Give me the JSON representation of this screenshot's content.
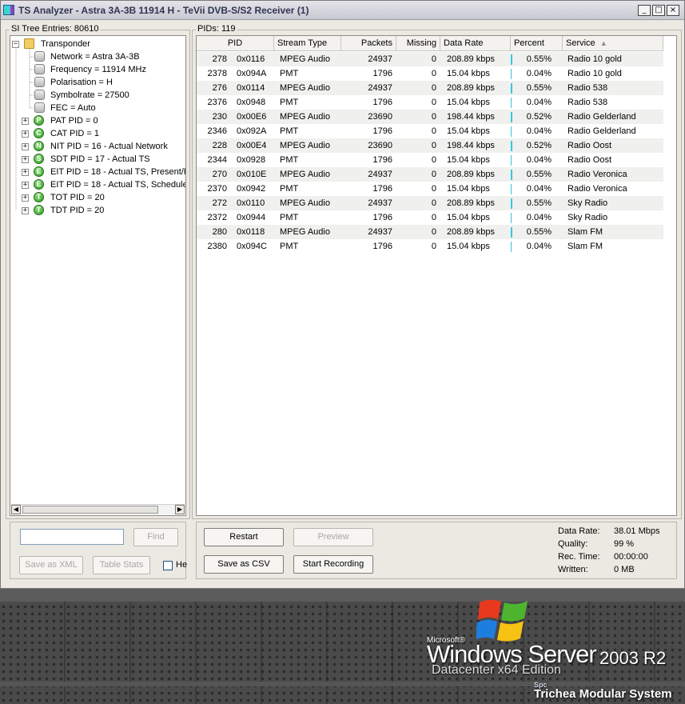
{
  "window": {
    "title": "TS Analyzer - Astra 3A-3B 11914 H - TeVii DVB-S/S2 Receiver (1)",
    "minimize_glyph": "_",
    "maximize_glyph": "□",
    "close_glyph": "×"
  },
  "si_tree": {
    "label": "SI Tree Entries: 80610",
    "root": {
      "label": "Transponder",
      "icon": "folder-icon",
      "expander": "−"
    },
    "items": [
      {
        "label": "Network = Astra 3A-3B",
        "icon": "gray-icon",
        "badge": ""
      },
      {
        "label": "Frequency = 11914 MHz",
        "icon": "gray-icon",
        "badge": ""
      },
      {
        "label": "Polarisation = H",
        "icon": "gray-icon",
        "badge": ""
      },
      {
        "label": "Symbolrate = 27500",
        "icon": "gray-icon",
        "badge": ""
      },
      {
        "label": "FEC = Auto",
        "icon": "gray-icon",
        "badge": ""
      },
      {
        "label": "PAT PID = 0",
        "icon": "green-icon",
        "badge": "P",
        "expander": "+"
      },
      {
        "label": "CAT PID = 1",
        "icon": "green-icon",
        "badge": "C",
        "expander": "+"
      },
      {
        "label": "NIT PID = 16 - Actual Network",
        "icon": "green-icon",
        "badge": "N",
        "expander": "+"
      },
      {
        "label": "SDT PID = 17 - Actual TS",
        "icon": "green-icon",
        "badge": "S",
        "expander": "+"
      },
      {
        "label": "EIT PID = 18 - Actual TS, Present/F",
        "icon": "green-icon",
        "badge": "E",
        "expander": "+"
      },
      {
        "label": "EIT PID = 18 - Actual TS, Schedule",
        "icon": "green-icon",
        "badge": "E",
        "expander": "+"
      },
      {
        "label": "TOT PID = 20",
        "icon": "green-icon",
        "badge": "T",
        "expander": "+"
      },
      {
        "label": "TDT PID = 20",
        "icon": "green-icon",
        "badge": "T",
        "expander": "+"
      }
    ],
    "scroll_left": "◀",
    "scroll_right": "▶"
  },
  "search": {
    "value": "",
    "find_label": "Find",
    "save_xml_label": "Save as XML",
    "table_stats_label": "Table Stats",
    "checkbox_label": "He"
  },
  "pids": {
    "label": "PIDs: 119",
    "columns": [
      "PID",
      "Stream Type",
      "Packets",
      "Missing",
      "Data Rate",
      "Percent",
      "Service"
    ],
    "sort_indicator": "▲",
    "rows": [
      {
        "pid": "278",
        "hex": "0x0116",
        "type": "MPEG Audio",
        "packets": "24937",
        "missing": "0",
        "rate": "208.89 kbps",
        "percent": "0.55%",
        "pct_value": 0.55,
        "service": "Radio 10 gold"
      },
      {
        "pid": "2378",
        "hex": "0x094A",
        "type": "PMT",
        "packets": "1796",
        "missing": "0",
        "rate": "15.04 kbps",
        "percent": "0.04%",
        "pct_value": 0.04,
        "service": "Radio 10 gold"
      },
      {
        "pid": "276",
        "hex": "0x0114",
        "type": "MPEG Audio",
        "packets": "24937",
        "missing": "0",
        "rate": "208.89 kbps",
        "percent": "0.55%",
        "pct_value": 0.55,
        "service": "Radio 538"
      },
      {
        "pid": "2376",
        "hex": "0x0948",
        "type": "PMT",
        "packets": "1796",
        "missing": "0",
        "rate": "15.04 kbps",
        "percent": "0.04%",
        "pct_value": 0.04,
        "service": "Radio 538"
      },
      {
        "pid": "230",
        "hex": "0x00E6",
        "type": "MPEG Audio",
        "packets": "23690",
        "missing": "0",
        "rate": "198.44 kbps",
        "percent": "0.52%",
        "pct_value": 0.52,
        "service": "Radio Gelderland"
      },
      {
        "pid": "2346",
        "hex": "0x092A",
        "type": "PMT",
        "packets": "1796",
        "missing": "0",
        "rate": "15.04 kbps",
        "percent": "0.04%",
        "pct_value": 0.04,
        "service": "Radio Gelderland"
      },
      {
        "pid": "228",
        "hex": "0x00E4",
        "type": "MPEG Audio",
        "packets": "23690",
        "missing": "0",
        "rate": "198.44 kbps",
        "percent": "0.52%",
        "pct_value": 0.52,
        "service": "Radio Oost"
      },
      {
        "pid": "2344",
        "hex": "0x0928",
        "type": "PMT",
        "packets": "1796",
        "missing": "0",
        "rate": "15.04 kbps",
        "percent": "0.04%",
        "pct_value": 0.04,
        "service": "Radio Oost"
      },
      {
        "pid": "270",
        "hex": "0x010E",
        "type": "MPEG Audio",
        "packets": "24937",
        "missing": "0",
        "rate": "208.89 kbps",
        "percent": "0.55%",
        "pct_value": 0.55,
        "service": "Radio Veronica"
      },
      {
        "pid": "2370",
        "hex": "0x0942",
        "type": "PMT",
        "packets": "1796",
        "missing": "0",
        "rate": "15.04 kbps",
        "percent": "0.04%",
        "pct_value": 0.04,
        "service": "Radio Veronica"
      },
      {
        "pid": "272",
        "hex": "0x0110",
        "type": "MPEG Audio",
        "packets": "24937",
        "missing": "0",
        "rate": "208.89 kbps",
        "percent": "0.55%",
        "pct_value": 0.55,
        "service": "Sky Radio"
      },
      {
        "pid": "2372",
        "hex": "0x0944",
        "type": "PMT",
        "packets": "1796",
        "missing": "0",
        "rate": "15.04 kbps",
        "percent": "0.04%",
        "pct_value": 0.04,
        "service": "Sky Radio"
      },
      {
        "pid": "280",
        "hex": "0x0118",
        "type": "MPEG Audio",
        "packets": "24937",
        "missing": "0",
        "rate": "208.89 kbps",
        "percent": "0.55%",
        "pct_value": 0.55,
        "service": "Slam FM"
      },
      {
        "pid": "2380",
        "hex": "0x094C",
        "type": "PMT",
        "packets": "1796",
        "missing": "0",
        "rate": "15.04 kbps",
        "percent": "0.04%",
        "pct_value": 0.04,
        "service": "Slam FM"
      }
    ]
  },
  "controls": {
    "restart_label": "Restart",
    "preview_label": "Preview",
    "save_csv_label": "Save as CSV",
    "start_recording_label": "Start Recording"
  },
  "stats": {
    "data_rate_label": "Data Rate:",
    "data_rate_value": "38.01 Mbps",
    "quality_label": "Quality:",
    "quality_value": "99 %",
    "rec_time_label": "Rec. Time:",
    "rec_time_value": "00:00:00",
    "written_label": "Written:",
    "written_value": "0 MB"
  },
  "desktop": {
    "microsoft": "Microsoft®",
    "windows_server": "Windows Server",
    "version": "2003 R2",
    "edition": "Datacenter x64 Edition",
    "spc": "Spc",
    "trichea": "Trichea Modular System"
  },
  "colors": {
    "window_bg": "#ece9e2",
    "row_alt": "#f0f0ee",
    "percent_bar": "#35c7df",
    "flag_red": "#e8391f",
    "flag_green": "#4eb42f",
    "flag_blue": "#1e7ee0",
    "flag_yellow": "#f7c213"
  }
}
